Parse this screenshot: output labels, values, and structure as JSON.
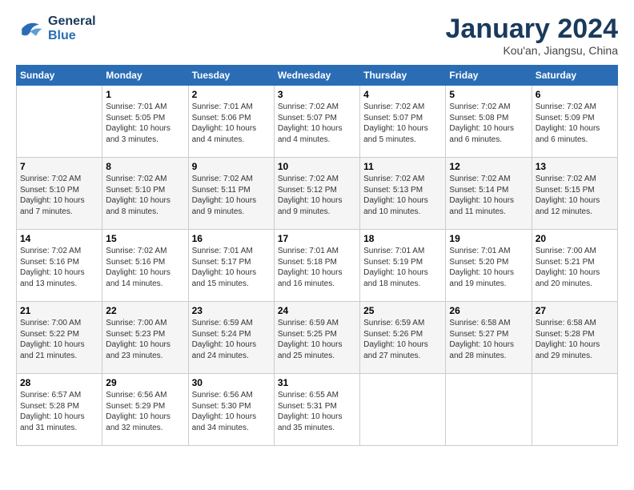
{
  "logo": {
    "line1": "General",
    "line2": "Blue"
  },
  "title": "January 2024",
  "subtitle": "Kou'an, Jiangsu, China",
  "header_days": [
    "Sunday",
    "Monday",
    "Tuesday",
    "Wednesday",
    "Thursday",
    "Friday",
    "Saturday"
  ],
  "weeks": [
    [
      {
        "day": "",
        "info": ""
      },
      {
        "day": "1",
        "info": "Sunrise: 7:01 AM\nSunset: 5:05 PM\nDaylight: 10 hours\nand 3 minutes."
      },
      {
        "day": "2",
        "info": "Sunrise: 7:01 AM\nSunset: 5:06 PM\nDaylight: 10 hours\nand 4 minutes."
      },
      {
        "day": "3",
        "info": "Sunrise: 7:02 AM\nSunset: 5:07 PM\nDaylight: 10 hours\nand 4 minutes."
      },
      {
        "day": "4",
        "info": "Sunrise: 7:02 AM\nSunset: 5:07 PM\nDaylight: 10 hours\nand 5 minutes."
      },
      {
        "day": "5",
        "info": "Sunrise: 7:02 AM\nSunset: 5:08 PM\nDaylight: 10 hours\nand 6 minutes."
      },
      {
        "day": "6",
        "info": "Sunrise: 7:02 AM\nSunset: 5:09 PM\nDaylight: 10 hours\nand 6 minutes."
      }
    ],
    [
      {
        "day": "7",
        "info": "Sunrise: 7:02 AM\nSunset: 5:10 PM\nDaylight: 10 hours\nand 7 minutes."
      },
      {
        "day": "8",
        "info": "Sunrise: 7:02 AM\nSunset: 5:10 PM\nDaylight: 10 hours\nand 8 minutes."
      },
      {
        "day": "9",
        "info": "Sunrise: 7:02 AM\nSunset: 5:11 PM\nDaylight: 10 hours\nand 9 minutes."
      },
      {
        "day": "10",
        "info": "Sunrise: 7:02 AM\nSunset: 5:12 PM\nDaylight: 10 hours\nand 9 minutes."
      },
      {
        "day": "11",
        "info": "Sunrise: 7:02 AM\nSunset: 5:13 PM\nDaylight: 10 hours\nand 10 minutes."
      },
      {
        "day": "12",
        "info": "Sunrise: 7:02 AM\nSunset: 5:14 PM\nDaylight: 10 hours\nand 11 minutes."
      },
      {
        "day": "13",
        "info": "Sunrise: 7:02 AM\nSunset: 5:15 PM\nDaylight: 10 hours\nand 12 minutes."
      }
    ],
    [
      {
        "day": "14",
        "info": "Sunrise: 7:02 AM\nSunset: 5:16 PM\nDaylight: 10 hours\nand 13 minutes."
      },
      {
        "day": "15",
        "info": "Sunrise: 7:02 AM\nSunset: 5:16 PM\nDaylight: 10 hours\nand 14 minutes."
      },
      {
        "day": "16",
        "info": "Sunrise: 7:01 AM\nSunset: 5:17 PM\nDaylight: 10 hours\nand 15 minutes."
      },
      {
        "day": "17",
        "info": "Sunrise: 7:01 AM\nSunset: 5:18 PM\nDaylight: 10 hours\nand 16 minutes."
      },
      {
        "day": "18",
        "info": "Sunrise: 7:01 AM\nSunset: 5:19 PM\nDaylight: 10 hours\nand 18 minutes."
      },
      {
        "day": "19",
        "info": "Sunrise: 7:01 AM\nSunset: 5:20 PM\nDaylight: 10 hours\nand 19 minutes."
      },
      {
        "day": "20",
        "info": "Sunrise: 7:00 AM\nSunset: 5:21 PM\nDaylight: 10 hours\nand 20 minutes."
      }
    ],
    [
      {
        "day": "21",
        "info": "Sunrise: 7:00 AM\nSunset: 5:22 PM\nDaylight: 10 hours\nand 21 minutes."
      },
      {
        "day": "22",
        "info": "Sunrise: 7:00 AM\nSunset: 5:23 PM\nDaylight: 10 hours\nand 23 minutes."
      },
      {
        "day": "23",
        "info": "Sunrise: 6:59 AM\nSunset: 5:24 PM\nDaylight: 10 hours\nand 24 minutes."
      },
      {
        "day": "24",
        "info": "Sunrise: 6:59 AM\nSunset: 5:25 PM\nDaylight: 10 hours\nand 25 minutes."
      },
      {
        "day": "25",
        "info": "Sunrise: 6:59 AM\nSunset: 5:26 PM\nDaylight: 10 hours\nand 27 minutes."
      },
      {
        "day": "26",
        "info": "Sunrise: 6:58 AM\nSunset: 5:27 PM\nDaylight: 10 hours\nand 28 minutes."
      },
      {
        "day": "27",
        "info": "Sunrise: 6:58 AM\nSunset: 5:28 PM\nDaylight: 10 hours\nand 29 minutes."
      }
    ],
    [
      {
        "day": "28",
        "info": "Sunrise: 6:57 AM\nSunset: 5:28 PM\nDaylight: 10 hours\nand 31 minutes."
      },
      {
        "day": "29",
        "info": "Sunrise: 6:56 AM\nSunset: 5:29 PM\nDaylight: 10 hours\nand 32 minutes."
      },
      {
        "day": "30",
        "info": "Sunrise: 6:56 AM\nSunset: 5:30 PM\nDaylight: 10 hours\nand 34 minutes."
      },
      {
        "day": "31",
        "info": "Sunrise: 6:55 AM\nSunset: 5:31 PM\nDaylight: 10 hours\nand 35 minutes."
      },
      {
        "day": "",
        "info": ""
      },
      {
        "day": "",
        "info": ""
      },
      {
        "day": "",
        "info": ""
      }
    ]
  ]
}
